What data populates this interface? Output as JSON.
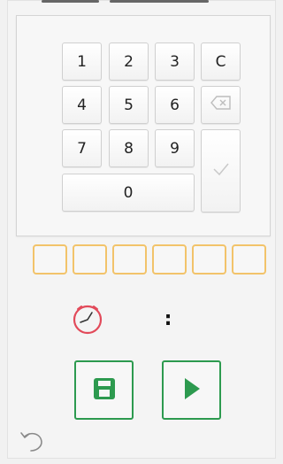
{
  "keypad": {
    "keys": {
      "k1": "1",
      "k2": "2",
      "k3": "3",
      "clear": "C",
      "k4": "4",
      "k5": "5",
      "k6": "6",
      "k7": "7",
      "k8": "8",
      "k9": "9",
      "k0": "0"
    },
    "icons": {
      "backspace": "backspace-icon",
      "confirm": "checkmark-icon"
    }
  },
  "code": {
    "slots": [
      "",
      "",
      "",
      "",
      "",
      ""
    ]
  },
  "timer": {
    "separator": ":",
    "icon": "clock-icon"
  },
  "actions": {
    "save_icon": "save-icon",
    "play_icon": "play-icon"
  },
  "footer": {
    "undo_icon": "undo-icon"
  },
  "colors": {
    "accent_green": "#2d9a4f",
    "slot_border": "#f2c36a",
    "clock_red": "#e24a5a"
  }
}
